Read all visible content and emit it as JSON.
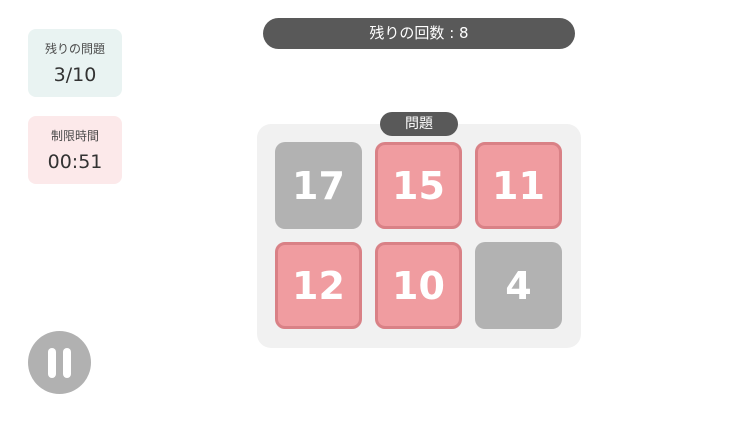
{
  "sidebar": {
    "remaining_problems": {
      "label": "残りの問題",
      "value": "3/10"
    },
    "time_limit": {
      "label": "制限時間",
      "value": "00:51"
    }
  },
  "header": {
    "attempts_text": "残りの回数 : 8"
  },
  "board": {
    "tag": "問題",
    "tiles": [
      {
        "number": "17",
        "state": "unselected",
        "color": "#b2b2b2"
      },
      {
        "number": "15",
        "state": "selected",
        "color": "#f09ca0"
      },
      {
        "number": "11",
        "state": "selected",
        "color": "#f09ca0"
      },
      {
        "number": "12",
        "state": "selected",
        "color": "#f09ca0"
      },
      {
        "number": "10",
        "state": "selected",
        "color": "#f09ca0"
      },
      {
        "number": "4",
        "state": "unselected",
        "color": "#b2b2b2"
      }
    ]
  },
  "controls": {
    "pause_icon": "pause-icon"
  }
}
